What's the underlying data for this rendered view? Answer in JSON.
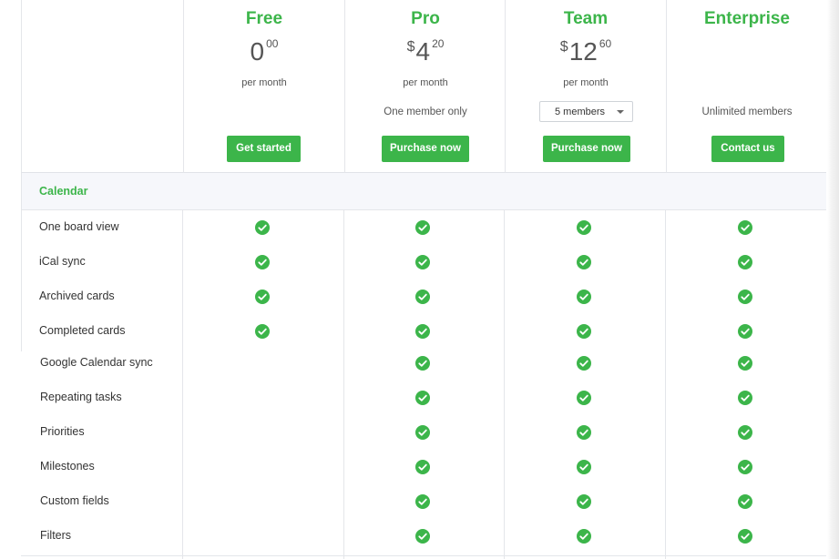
{
  "plans": [
    {
      "name": "Free",
      "currency": "",
      "amount": "0",
      "cents": "00",
      "period": "per month",
      "members": "",
      "cta": "Get started"
    },
    {
      "name": "Pro",
      "currency": "$",
      "amount": "4",
      "cents": "20",
      "period": "per month",
      "members": "One member only",
      "cta": "Purchase now"
    },
    {
      "name": "Team",
      "currency": "$",
      "amount": "12",
      "cents": "60",
      "period": "per month",
      "members_select": "5 members",
      "cta": "Purchase now"
    },
    {
      "name": "Enterprise",
      "members": "Unlimited members",
      "cta": "Contact us"
    }
  ],
  "section": {
    "label": "Calendar"
  },
  "features": [
    {
      "label": "One board view",
      "included": [
        true,
        true,
        true,
        true
      ]
    },
    {
      "label": "iCal sync",
      "included": [
        true,
        true,
        true,
        true
      ]
    },
    {
      "label": "Archived cards",
      "included": [
        true,
        true,
        true,
        true
      ]
    },
    {
      "label": "Completed cards",
      "included": [
        true,
        true,
        true,
        true
      ]
    },
    {
      "label": "Google Calendar sync",
      "included": [
        false,
        true,
        true,
        true
      ]
    },
    {
      "label": "Repeating tasks",
      "included": [
        false,
        true,
        true,
        true
      ]
    },
    {
      "label": "Priorities",
      "included": [
        false,
        true,
        true,
        true
      ]
    },
    {
      "label": "Milestones",
      "included": [
        false,
        true,
        true,
        true
      ]
    },
    {
      "label": "Custom fields",
      "included": [
        false,
        true,
        true,
        true
      ]
    },
    {
      "label": "Filters",
      "included": [
        false,
        true,
        true,
        true
      ]
    }
  ],
  "colors": {
    "accent": "#3cb54a",
    "section_bg": "#f6f7fb"
  },
  "icons": {
    "check": "check-circle-icon",
    "dropdown": "chevron-down-icon"
  }
}
